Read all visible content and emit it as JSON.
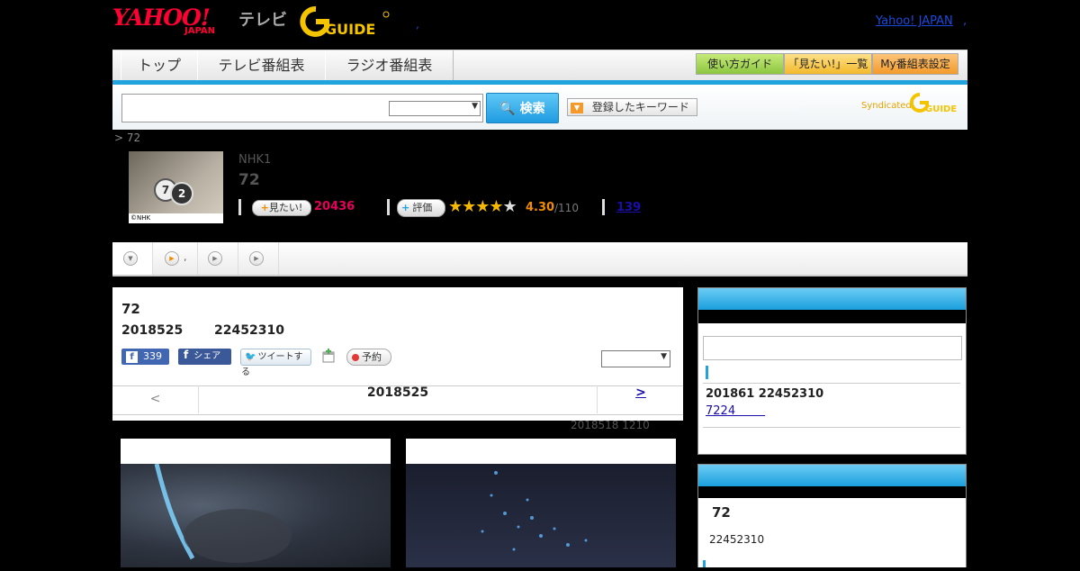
{
  "header": {
    "yahoo_logo_text": "YAHOO!",
    "yahoo_logo_sub": "JAPAN",
    "tv_label": "テレビ",
    "gguide_logo_text": "GUIDE",
    "top_link": "Yahoo! JAPAN",
    "dot": ","
  },
  "nav": {
    "tabs": [
      {
        "label": "トップ"
      },
      {
        "label": "テレビ番組表"
      },
      {
        "label": "ラジオ番組表"
      }
    ],
    "buttons": [
      {
        "label": "使い方ガイド",
        "color": "#9fd447"
      },
      {
        "label": "「見たい!」一覧",
        "color": "#f7c948"
      },
      {
        "label": "My番組表設定",
        "color": "#f7a13a"
      }
    ]
  },
  "search": {
    "input_value": "",
    "select_value": "",
    "button_label": "検索",
    "keyword_button_label": "登録したキーワード",
    "syndicated_label": "Syndicated",
    "synd_logo_text": "GUIDE"
  },
  "breadcrumb": "> 72",
  "program": {
    "thumb_credit": "©NHK",
    "channel": "NHK1",
    "title": "72",
    "mitai_label": "見たい!",
    "mitai_count": "20436",
    "hyoka_label": "評価",
    "stars": "★★★★★",
    "rating": "4.30",
    "rating_count": "/110",
    "review_count": "139"
  },
  "tabstrip": {
    "tab2_suffix": ","
  },
  "main": {
    "title": "72",
    "date": "2018525",
    "time": "22452310",
    "fb_like_count": "339",
    "fb_share_label": "シェア",
    "tweet_label": "ツイートする",
    "yoyaku_label": "予約",
    "select_value": "",
    "pager_prev": "<",
    "pager_date": "2018525",
    "pager_next": ">",
    "update_note": "2018518  1210"
  },
  "sidebar": {
    "box1_date": "201861  22452310",
    "box1_link": "7224        ",
    "box2_title": "72",
    "box2_time": "22452310"
  },
  "colors": {
    "accent_blue": "#21a3de",
    "mitai_pink": "#e5005a",
    "rating_orange": "#f08c00",
    "link_blue": "#1a0dab"
  }
}
